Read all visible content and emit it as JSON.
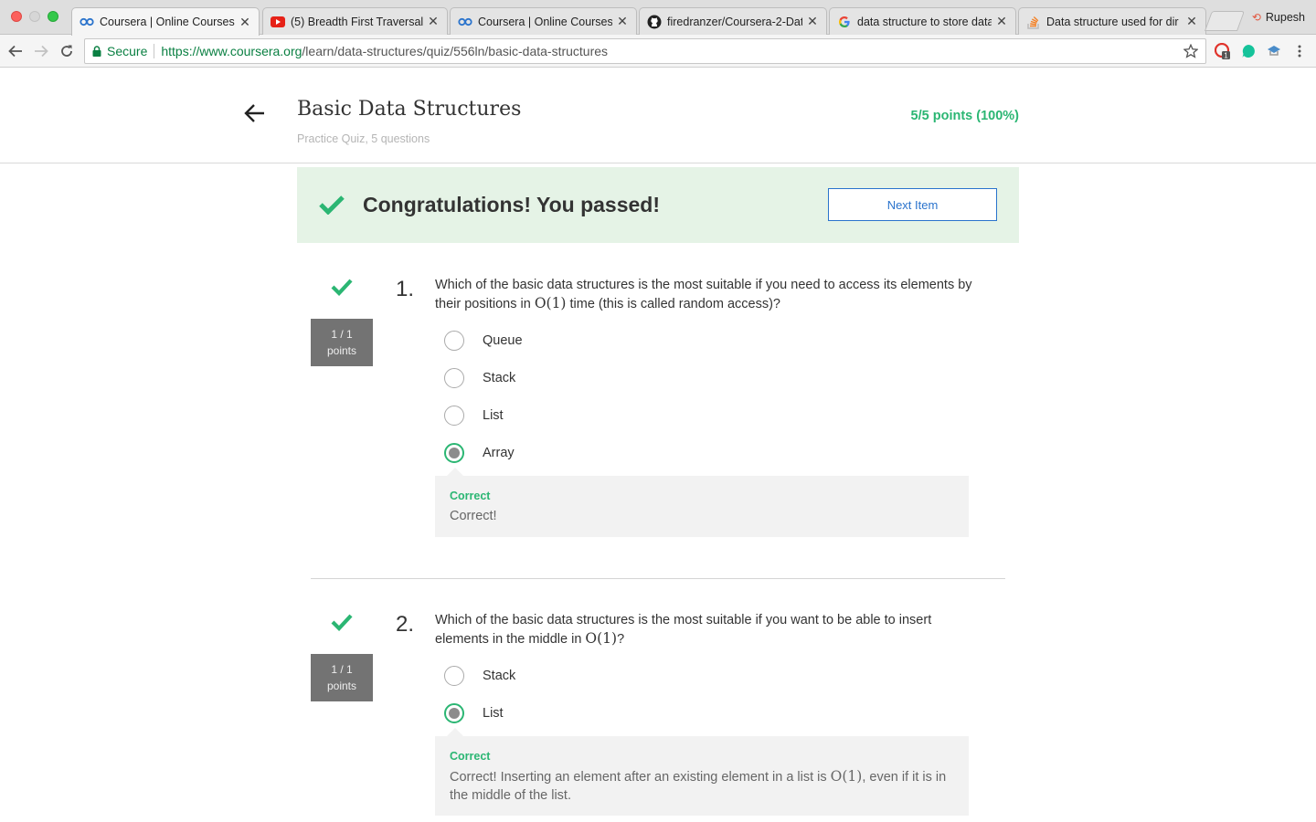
{
  "browser": {
    "tabs": [
      {
        "title": "Coursera | Online Courses",
        "icon": "coursera-icon"
      },
      {
        "title": "(5) Breadth First Traversal",
        "icon": "youtube-icon"
      },
      {
        "title": "Coursera | Online Courses",
        "icon": "coursera-icon"
      },
      {
        "title": "firedranzer/Coursera-2-Dat",
        "icon": "github-icon"
      },
      {
        "title": "data structure to store data",
        "icon": "google-icon"
      },
      {
        "title": "Data structure used for dir",
        "icon": "stackoverflow-icon"
      }
    ],
    "profile_name": "Rupesh",
    "secure_label": "Secure",
    "url_host": "https://www.coursera.org",
    "url_path": "/learn/data-structures/quiz/556ln/basic-data-structures",
    "extension_badge": "1"
  },
  "header": {
    "title": "Basic Data Structures",
    "subtitle": "Practice Quiz, 5 questions",
    "score": "5/5 points (100%)"
  },
  "banner": {
    "message": "Congratulations! You passed!",
    "next_button": "Next Item"
  },
  "questions": [
    {
      "number": "1.",
      "points_line1": "1 / 1",
      "points_line2": "points",
      "text_before": "Which of the basic data structures is the most suitable if you need to access its elements by their positions in ",
      "math": "O(1)",
      "text_after": " time (this is called random access)?",
      "options": [
        "Queue",
        "Stack",
        "List",
        "Array"
      ],
      "selected": "Array",
      "feedback_label": "Correct",
      "feedback_text": "Correct!"
    },
    {
      "number": "2.",
      "points_line1": "1 / 1",
      "points_line2": "points",
      "text_before": "Which of the basic data structures is the most suitable if you want to be able to insert elements in the middle in ",
      "math": "O(1)",
      "text_after": "?",
      "options": [
        "Stack",
        "List"
      ],
      "selected": "List",
      "feedback_label": "Correct",
      "feedback_text_before": "Correct! Inserting an element after an existing element in a list is ",
      "feedback_math": "O(1)",
      "feedback_text_after": ", even if it is in the middle of the list."
    }
  ],
  "colors": {
    "success_green": "#2bb673",
    "link_blue": "#2a73cc",
    "banner_bg": "#e5f3e6"
  }
}
